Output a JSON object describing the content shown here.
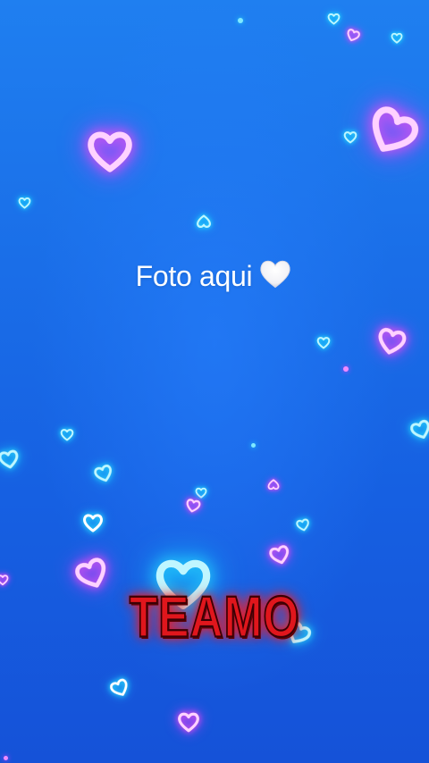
{
  "caption": {
    "text": "Foto aqui",
    "emoji_icon": "white-heart-icon"
  },
  "title": {
    "text": "TEAMO",
    "color": "#e0161c"
  },
  "background": {
    "color": "#1a6ee8"
  },
  "decorations": {
    "icon": "neon-heart-outline-icon",
    "colors": [
      "#29e3ff",
      "#ff4df2"
    ]
  }
}
